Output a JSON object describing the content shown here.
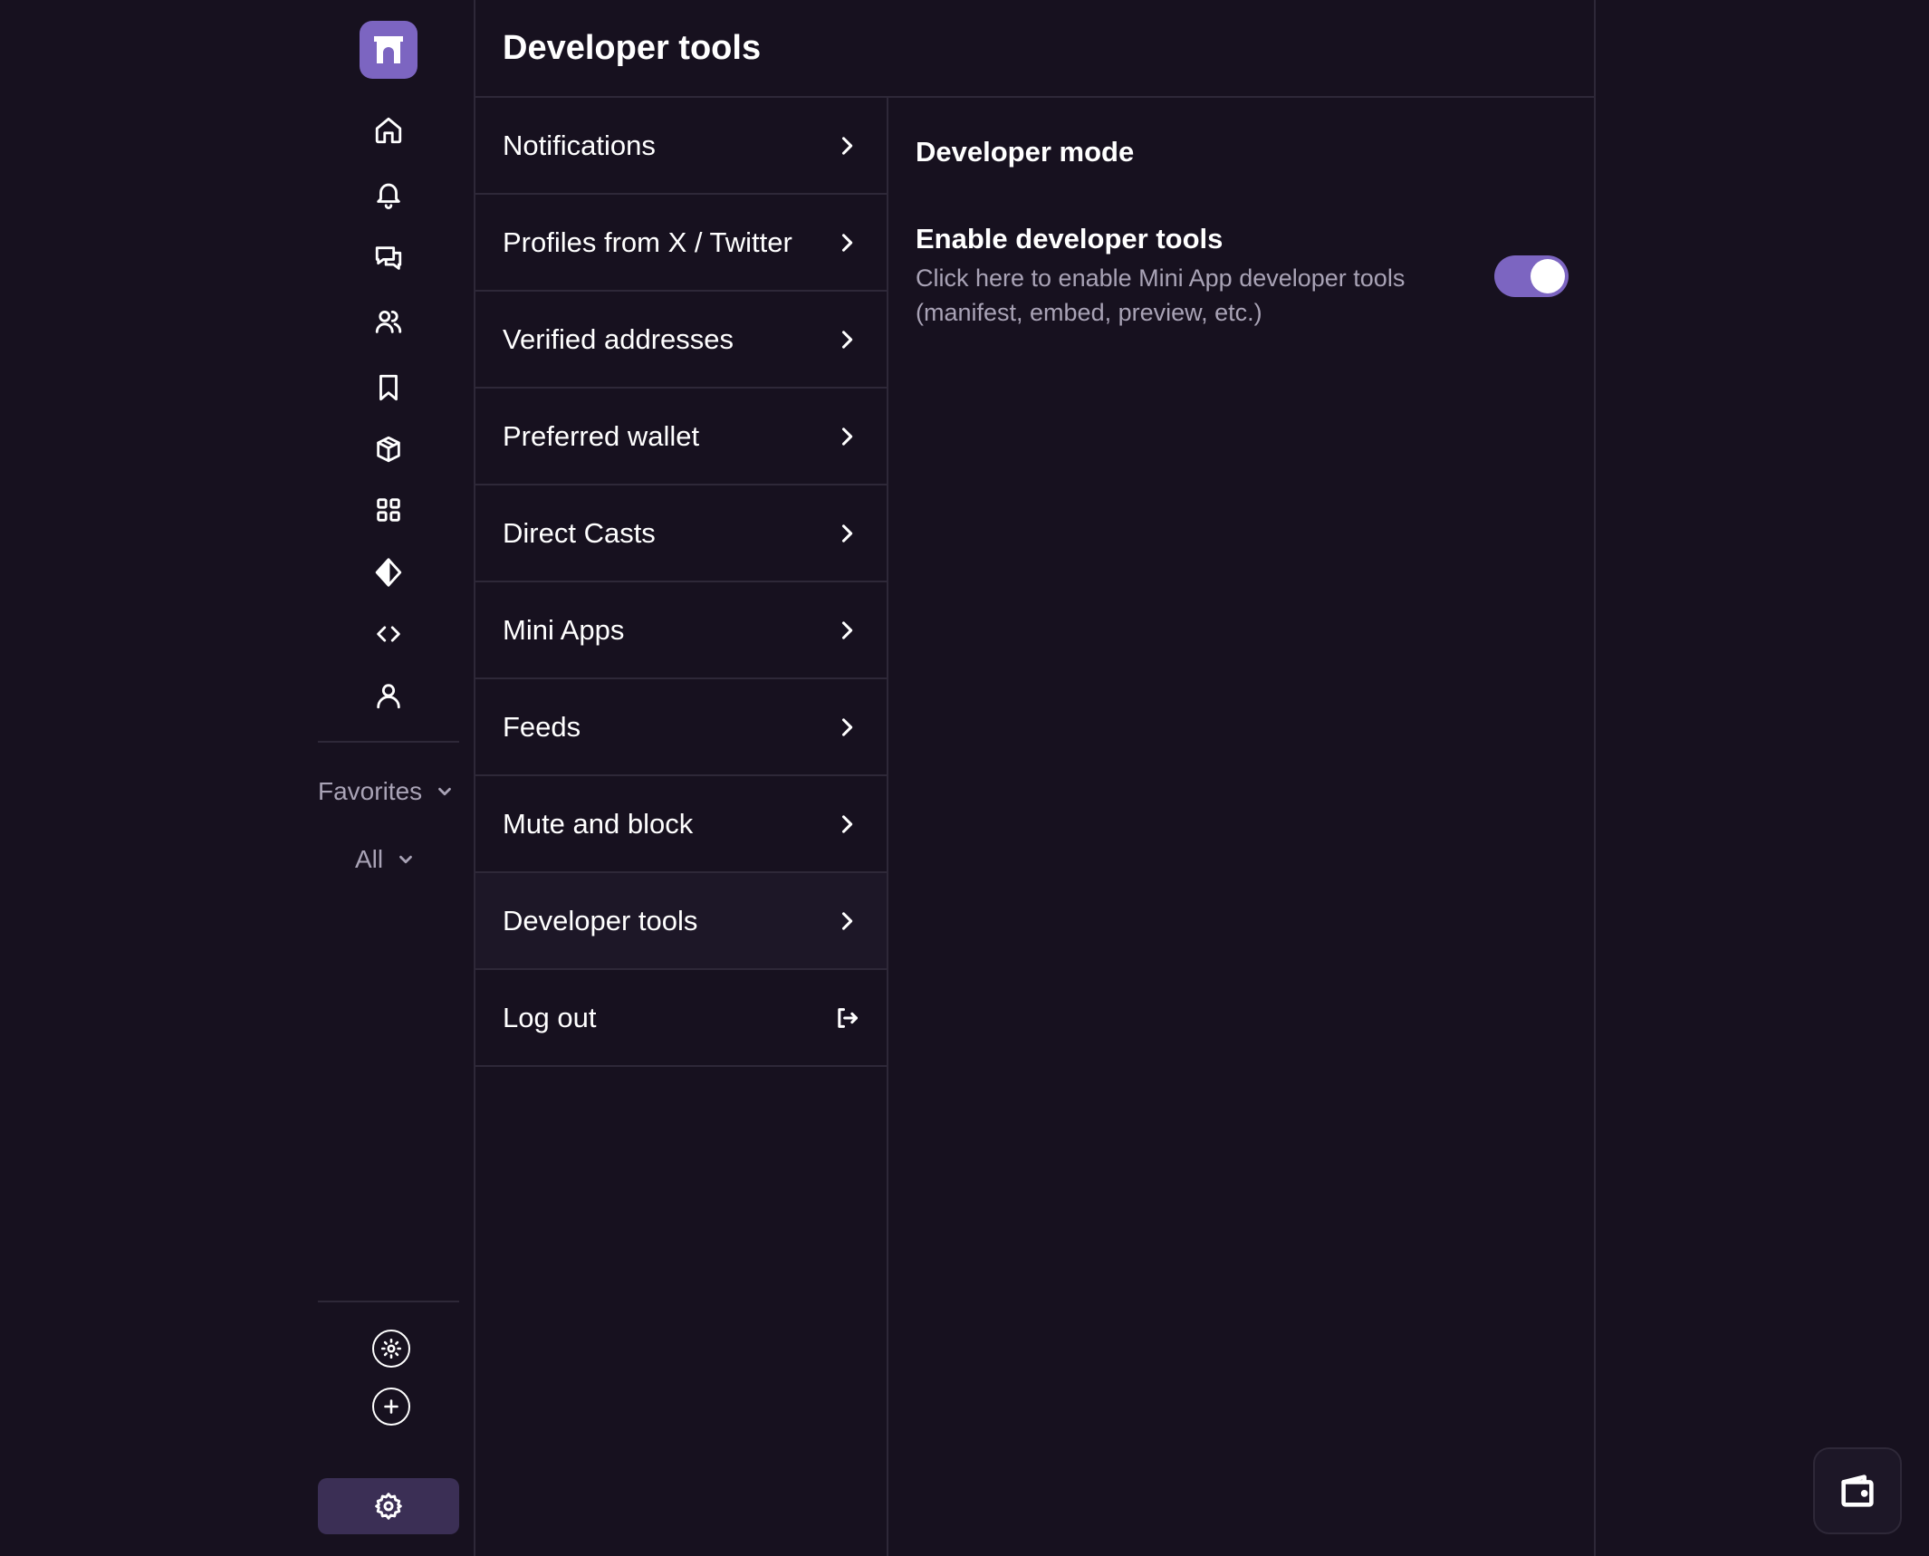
{
  "header": {
    "title": "Developer tools"
  },
  "rail": {
    "logo_icon": "farcaster-logo-icon",
    "icons": [
      "home-icon",
      "bell-icon",
      "chat-icon",
      "users-icon",
      "bookmark-icon",
      "cube-icon",
      "grid-icon",
      "diamond-icon",
      "code-icon",
      "user-icon"
    ],
    "favorites_label": "Favorites",
    "all_label": "All",
    "bottom_icons": [
      "gear-circle-icon",
      "plus-circle-icon"
    ],
    "settings_icon": "gear-icon"
  },
  "menu": {
    "items": [
      {
        "label": "Notifications",
        "icon": "chevron-right-icon"
      },
      {
        "label": "Profiles from X / Twitter",
        "icon": "chevron-right-icon"
      },
      {
        "label": "Verified addresses",
        "icon": "chevron-right-icon"
      },
      {
        "label": "Preferred wallet",
        "icon": "chevron-right-icon"
      },
      {
        "label": "Direct Casts",
        "icon": "chevron-right-icon"
      },
      {
        "label": "Mini Apps",
        "icon": "chevron-right-icon"
      },
      {
        "label": "Feeds",
        "icon": "chevron-right-icon"
      },
      {
        "label": "Mute and block",
        "icon": "chevron-right-icon"
      },
      {
        "label": "Developer tools",
        "icon": "chevron-right-icon",
        "active": true
      },
      {
        "label": "Log out",
        "icon": "logout-icon"
      }
    ]
  },
  "detail": {
    "section_title": "Developer mode",
    "setting_title": "Enable developer tools",
    "setting_desc": "Click here to enable Mini App developer tools (manifest, embed, preview, etc.)",
    "toggle_on": true
  },
  "colors": {
    "background": "#17111f",
    "accent": "#7c65c1",
    "border": "#2e2838",
    "muted_text": "#a9a3b6"
  },
  "wallet_icon": "wallet-icon"
}
